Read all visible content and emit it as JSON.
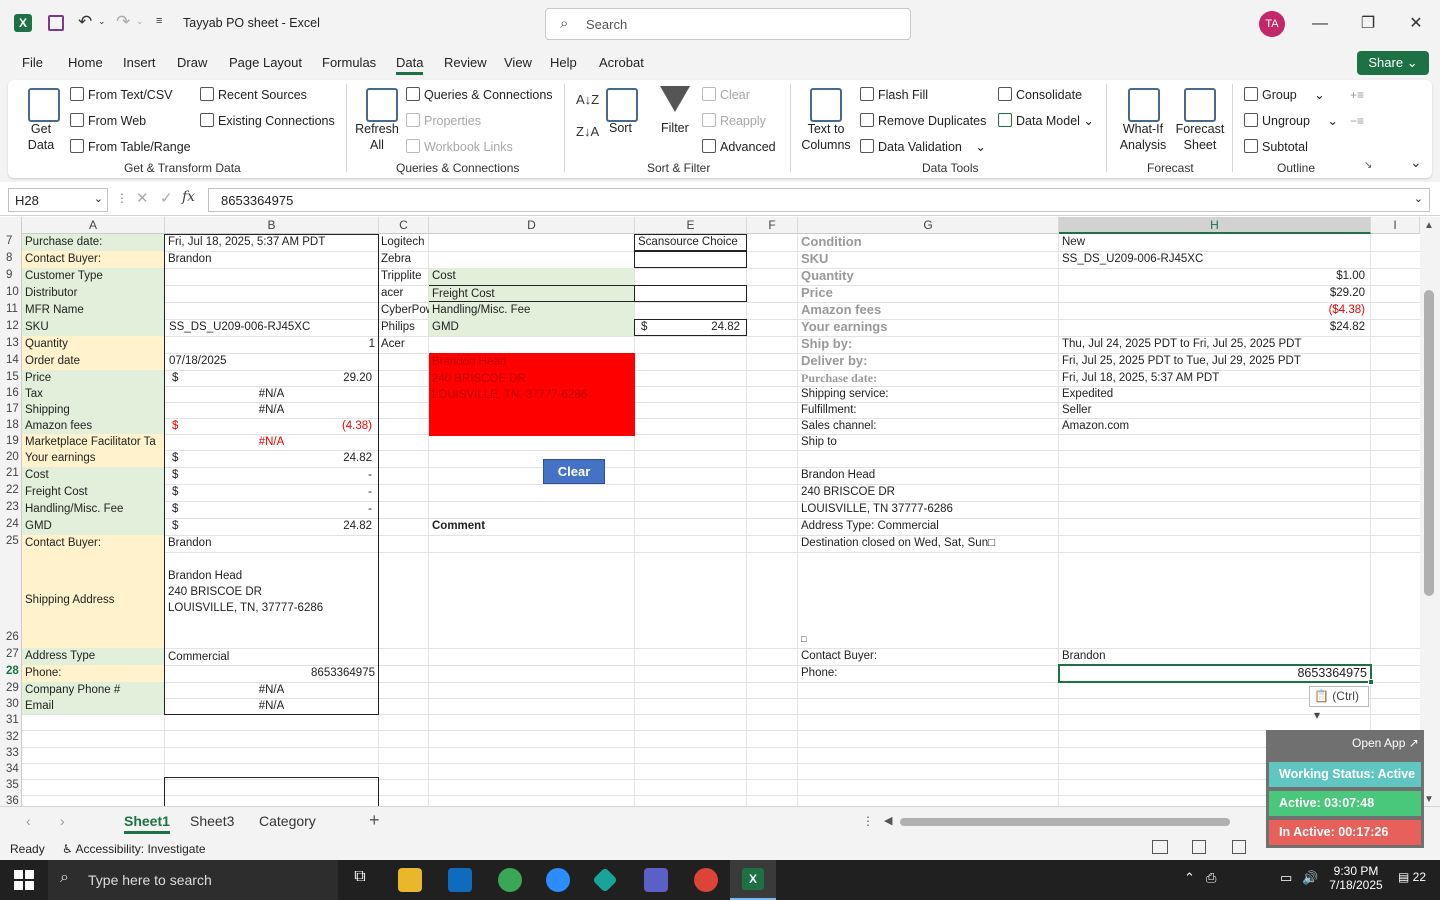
{
  "app": {
    "title": "Tayyab PO sheet  -  Excel",
    "search_placeholder": "Search",
    "avatar_initials": "TA",
    "share_label": "Share"
  },
  "menu": [
    "File",
    "Home",
    "Insert",
    "Draw",
    "Page Layout",
    "Formulas",
    "Data",
    "Review",
    "View",
    "Help",
    "Acrobat"
  ],
  "ribbon": {
    "get_data": "Get\nData",
    "from_text": "From Text/CSV",
    "from_web": "From Web",
    "from_table": "From Table/Range",
    "recent_sources": "Recent Sources",
    "existing_connections": "Existing Connections",
    "grp_get": "Get & Transform Data",
    "refresh_all": "Refresh\nAll",
    "queries_connections": "Queries & Connections",
    "properties": "Properties",
    "workbook_links": "Workbook Links",
    "grp_queries": "Queries & Connections",
    "sort": "Sort",
    "filter": "Filter",
    "clear": "Clear",
    "reapply": "Reapply",
    "advanced": "Advanced",
    "grp_sort": "Sort & Filter",
    "text_to_columns": "Text to\nColumns",
    "flash_fill": "Flash Fill",
    "remove_duplicates": "Remove Duplicates",
    "data_validation": "Data Validation",
    "consolidate": "Consolidate",
    "data_model": "Data Model",
    "grp_tools": "Data Tools",
    "what_if": "What-If\nAnalysis",
    "forecast_sheet": "Forecast\nSheet",
    "grp_forecast": "Forecast",
    "group": "Group",
    "ungroup": "Ungroup",
    "subtotal": "Subtotal",
    "grp_outline": "Outline"
  },
  "formula_bar": {
    "name_box": "H28",
    "fx": "fx",
    "value": "8653364975"
  },
  "columns": [
    "A",
    "B",
    "C",
    "D",
    "E",
    "F",
    "G",
    "H",
    "I"
  ],
  "rows": [
    "7",
    "8",
    "9",
    "10",
    "11",
    "12",
    "13",
    "14",
    "15",
    "16",
    "17",
    "18",
    "19",
    "20",
    "21",
    "22",
    "23",
    "24",
    "25",
    "26",
    "27",
    "28",
    "29",
    "30",
    "31",
    "32",
    "33",
    "34",
    "35",
    "36"
  ],
  "cells": {
    "a7": "Purchase date:",
    "b7": "Fri, Jul 18, 2025, 5:37 AM PDT",
    "c7": "Logitech",
    "e7": "Scansource Choice",
    "g7": "Condition",
    "h7": "New",
    "a8": "Contact Buyer:",
    "b8": "Brandon",
    "c8": "Zebra",
    "g8": "SKU",
    "h8": "SS_DS_U209-006-RJ45XC",
    "a9": "Customer Type",
    "c9": "Tripplite",
    "d9": "Cost",
    "g9": "Quantity",
    "h9": "$1.00",
    "a10": "Distributor",
    "c10": "acer",
    "d10": "Freight Cost",
    "g10": "Price",
    "h10": "$29.20",
    "a11": "MFR Name",
    "c11": "CyberPow",
    "d11": "Handling/Misc. Fee",
    "g11": "Amazon fees",
    "h11": "($4.38)",
    "a12": "SKU",
    "b12": "SS_DS_U209-006-RJ45XC",
    "c12": "Philips",
    "d12": "GMD",
    "e12_cur": "$",
    "e12": "24.82",
    "g12": "Your earnings",
    "h12": "$24.82",
    "a13": "Quantity",
    "b13": "1",
    "c13": "Acer",
    "g13": "Ship by:",
    "h13": "Thu, Jul 24, 2025 PDT to Fri, Jul 25, 2025 PDT",
    "a14": "Order date",
    "b14": "07/18/2025",
    "d14": "Brandon Head",
    "g14": "Deliver by:",
    "h14": "Fri, Jul 25, 2025 PDT to Tue, Jul 29, 2025 PDT",
    "a15": "Price",
    "b15_cur": "$",
    "b15": "29.20",
    "d15": "240 BRISCOE DR",
    "g15": "Purchase date:",
    "h15": "Fri, Jul 18, 2025, 5:37 AM PDT",
    "a16": "Tax",
    "b16": "#N/A",
    "d16": "LOUISVILLE, TN, 37777-6286",
    "g16": "Shipping service:",
    "h16": "Expedited",
    "a17": "Shipping",
    "b17": "#N/A",
    "g17": "Fulfillment:",
    "h17": "Seller",
    "a18": "Amazon fees",
    "b18_cur": "$",
    "b18": "(4.38)",
    "g18": "Sales channel:",
    "h18": "Amazon.com",
    "a19": "Marketplace Facilitator Ta",
    "b19": "#N/A",
    "g19": "Ship to",
    "a20": "Your earnings",
    "b20_cur": "$",
    "b20": "24.82",
    "clear_button": "Clear",
    "a21": "Cost",
    "b21_cur": "$",
    "b21": "-",
    "g21": "Brandon Head",
    "a22": "Freight Cost",
    "b22_cur": "$",
    "b22": "-",
    "g22": "240 BRISCOE DR",
    "a23": "Handling/Misc. Fee",
    "b23_cur": "$",
    "b23": "-",
    "g23": "LOUISVILLE, TN 37777-6286",
    "a24": "GMD",
    "b24_cur": "$",
    "b24": "24.82",
    "d24": "Comment",
    "g24": "Address Type:  Commercial",
    "a25": "Contact Buyer:",
    "b25": "Brandon",
    "g25": "Destination closed on Wed, Sat, Sun□",
    "a26": "Shipping Address",
    "b26_1": "Brandon Head",
    "b26_2": "240 BRISCOE DR",
    "b26_3": "LOUISVILLE, TN, 37777-6286",
    "g26": "□",
    "a27": "Address Type",
    "b27": "Commercial",
    "g27": "Contact Buyer:",
    "h27": "Brandon",
    "a28": "Phone:",
    "b28": "8653364975",
    "g28": "Phone:",
    "h28": "8653364975",
    "a29": "Company Phone #",
    "b29": "#N/A",
    "a30": "Email",
    "b30": "#N/A"
  },
  "paste_options": "(Ctrl)",
  "working_status": {
    "open_app": "Open App ↗",
    "status": "Working Status: Active",
    "active": "Active: 03:07:48",
    "inactive": "In Active: 00:17:26"
  },
  "sheets": [
    "Sheet1",
    "Sheet3",
    "Category"
  ],
  "status": {
    "ready": "Ready",
    "accessibility": "Accessibility: Investigate"
  },
  "taskbar": {
    "search_placeholder": "Type here to search",
    "time": "9:30 PM",
    "date": "7/18/2025",
    "notif": "22"
  },
  "colors": {
    "excel_green": "#1e7145",
    "cell_green": "#e2efda",
    "cell_yellow": "#fff2cc",
    "red": "#ff0000",
    "clear_blue": "#4472c4"
  }
}
